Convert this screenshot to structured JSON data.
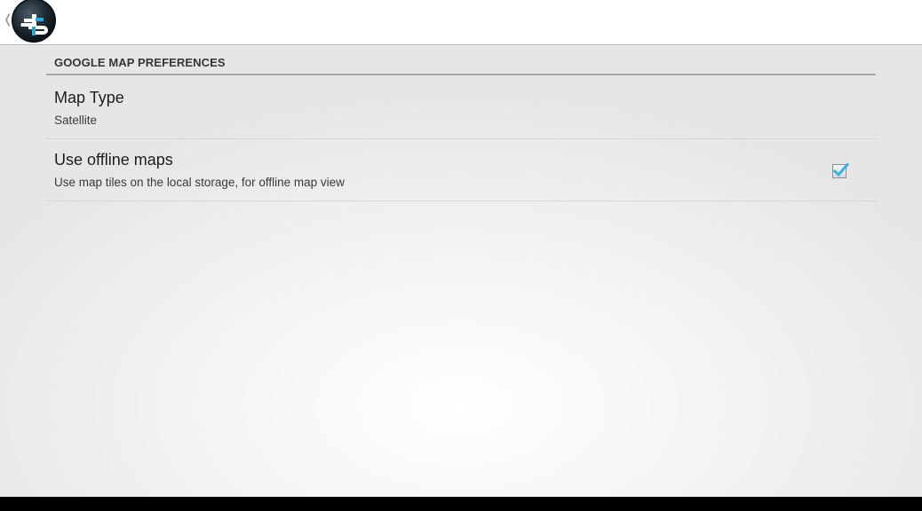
{
  "action_bar": {
    "up_icon": "chevron-left-icon",
    "logo_icon": "app-logo-icon"
  },
  "preferences": {
    "category_title": "GOOGLE MAP PREFERENCES",
    "items": [
      {
        "title": "Map Type",
        "summary": "Satellite"
      },
      {
        "title": "Use offline maps",
        "summary": "Use map tiles on the local storage, for offline map view",
        "checked": true
      }
    ]
  },
  "colors": {
    "accent": "#33b5e5",
    "text_primary": "#1e1e1e",
    "text_secondary": "#3a3a3a"
  }
}
